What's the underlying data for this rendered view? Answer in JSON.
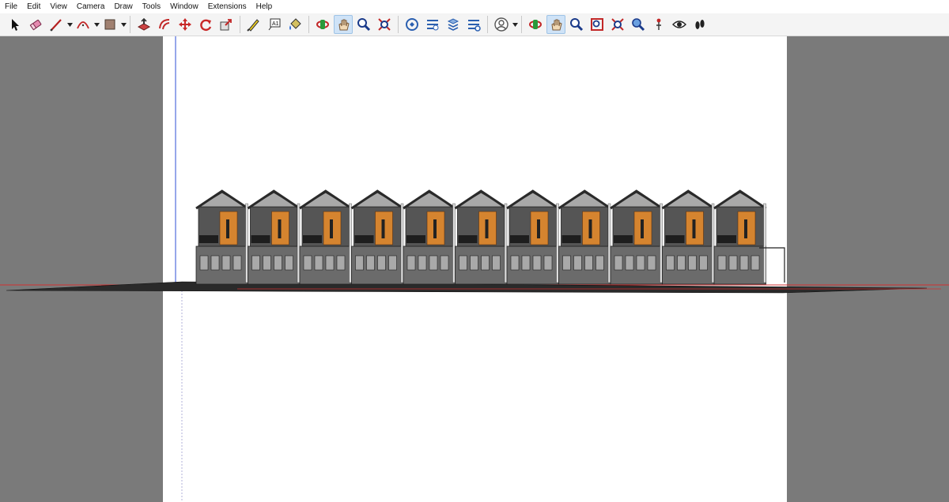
{
  "menu": [
    "File",
    "Edit",
    "View",
    "Camera",
    "Draw",
    "Tools",
    "Window",
    "Extensions",
    "Help"
  ],
  "toolbar": {
    "tools": [
      {
        "name": "select-tool-icon"
      },
      {
        "name": "eraser-tool-icon"
      },
      {
        "name": "line-tool-icon",
        "dropdown": true
      },
      {
        "name": "arc-tool-icon",
        "dropdown": true
      },
      {
        "name": "rectangle-tool-icon",
        "dropdown": true
      },
      {
        "sep": true
      },
      {
        "name": "push-pull-tool-icon"
      },
      {
        "name": "offset-tool-icon"
      },
      {
        "name": "move-tool-icon"
      },
      {
        "name": "rotate-tool-icon"
      },
      {
        "name": "scale-tool-icon"
      },
      {
        "sep": true
      },
      {
        "name": "tape-measure-tool-icon"
      },
      {
        "name": "text-tool-icon"
      },
      {
        "name": "paint-bucket-tool-icon"
      },
      {
        "sep": true
      },
      {
        "name": "orbit-tool-icon"
      },
      {
        "name": "pan-tool-icon",
        "active": true
      },
      {
        "name": "zoom-tool-icon"
      },
      {
        "name": "zoom-extents-tool-icon"
      },
      {
        "sep": true
      },
      {
        "name": "3d-warehouse-icon"
      },
      {
        "name": "extension-warehouse-icon"
      },
      {
        "name": "layout-send-icon"
      },
      {
        "name": "extension-manager-icon"
      },
      {
        "sep": true
      },
      {
        "name": "account-user-icon",
        "dropdown": true
      },
      {
        "sep": true
      },
      {
        "name": "orbit-camera-icon"
      },
      {
        "name": "pan-camera-icon",
        "active": true
      },
      {
        "name": "zoom-camera-icon"
      },
      {
        "name": "zoom-window-icon"
      },
      {
        "name": "zoom-extents-camera-icon"
      },
      {
        "name": "previous-view-icon"
      },
      {
        "name": "position-camera-icon"
      },
      {
        "name": "look-around-icon"
      },
      {
        "name": "walk-icon"
      }
    ]
  },
  "colors": {
    "background_gray": "#7a7a7a",
    "canvas_white": "#ffffff",
    "axis_blue": "#2c4cd6",
    "axis_red": "#d23030",
    "axis_green": "#35a035",
    "wall_gray": "#6b6b6b",
    "roof_dark": "#2a2a2a",
    "facade_orange": "#d5842f",
    "glass_gray": "#a9a9a9"
  },
  "scene": {
    "house_count": 11
  }
}
